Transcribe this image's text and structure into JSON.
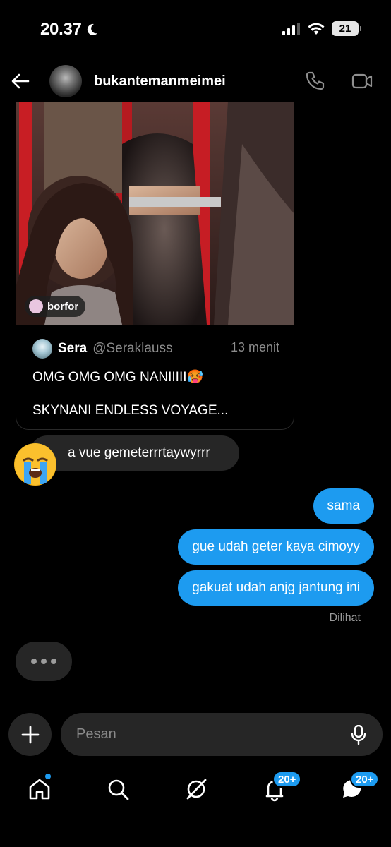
{
  "status_bar": {
    "time": "20.37",
    "battery": "21"
  },
  "header": {
    "username": "bukantemanmeimei"
  },
  "shared_post": {
    "tag_label": "borfor",
    "author_name": "Sera",
    "author_handle": "@Seraklauss",
    "time": "13 menit",
    "line1": "OMG OMG OMG NANIIIII🥵",
    "line2": "SKYNANI ENDLESS VOYAGE..."
  },
  "messages": {
    "received_text": "a vue gemeterrrtaywyrrr",
    "sent": [
      "sama",
      "gue udah geter kaya cimoyy",
      "gakuat udah anjg jantung ini"
    ],
    "seen_label": "Dilihat"
  },
  "composer": {
    "placeholder": "Pesan"
  },
  "tabbar": {
    "notifications_badge": "20+",
    "messages_badge": "20+"
  },
  "colors": {
    "accent": "#1d9bf0",
    "bubble_received": "#262626",
    "background": "#000000"
  }
}
